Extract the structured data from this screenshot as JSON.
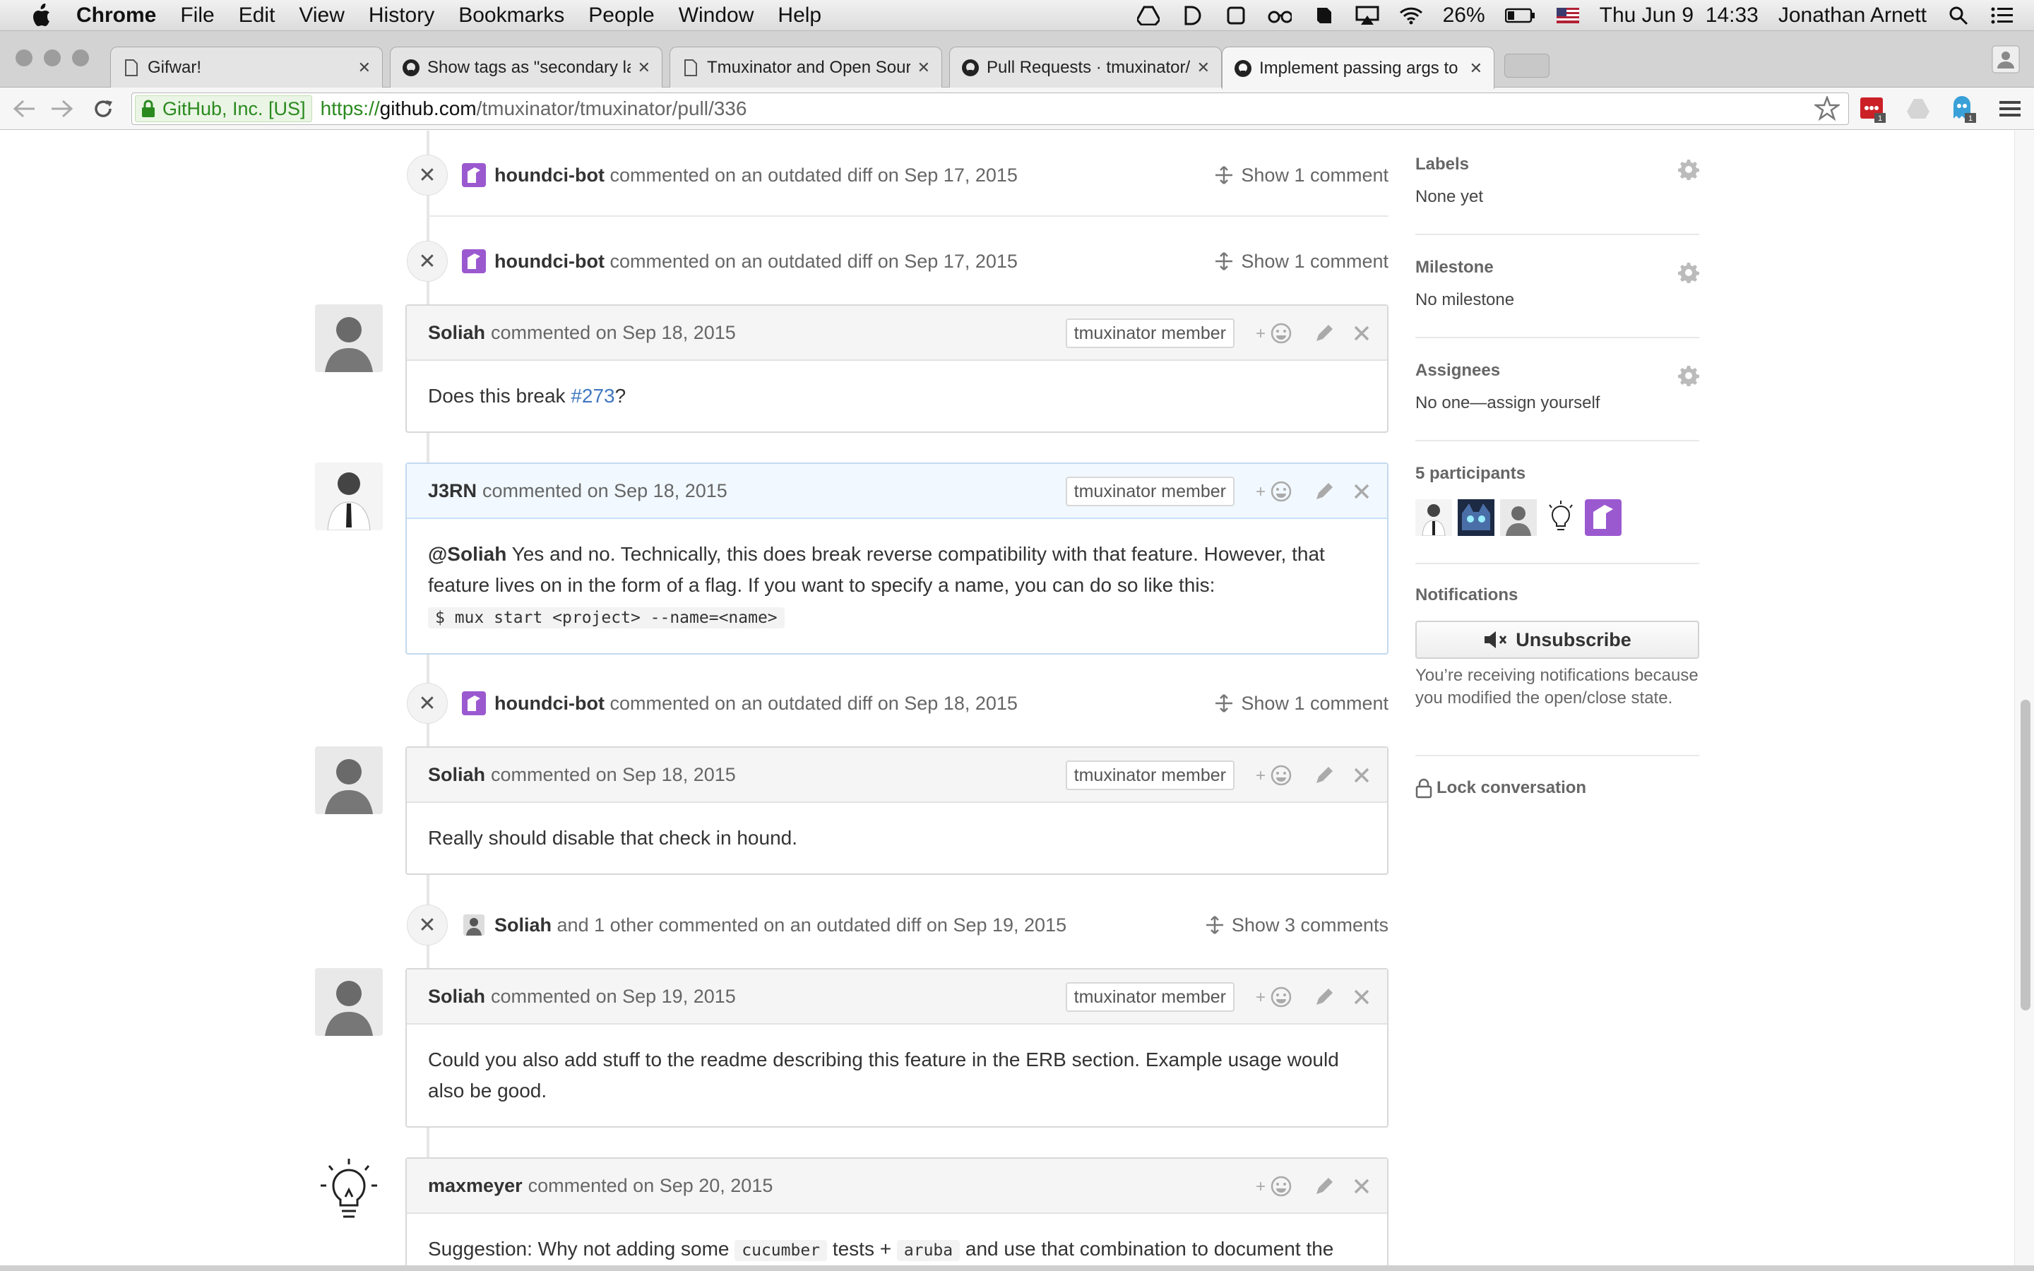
{
  "menubar": {
    "app": "Chrome",
    "items": [
      "File",
      "Edit",
      "View",
      "History",
      "Bookmarks",
      "People",
      "Window",
      "Help"
    ],
    "battery": "26%",
    "clock": "Thu Jun 9  14:33",
    "user": "Jonathan Arnett"
  },
  "tabs": [
    {
      "title": "Gifwar!",
      "icon": "document-icon"
    },
    {
      "title": "Show tags as \"secondary la",
      "icon": "github-icon"
    },
    {
      "title": "Tmuxinator and Open Sourc",
      "icon": "document-icon"
    },
    {
      "title": "Pull Requests · tmuxinator/t",
      "icon": "github-icon"
    },
    {
      "title": "Implement passing args to",
      "icon": "github-icon"
    }
  ],
  "address": {
    "ev_label": "GitHub, Inc. [US]",
    "scheme": "https://",
    "host": "github.com",
    "path": "/tmuxinator/tmuxinator/pull/336",
    "ext_badge_1": "1",
    "ext_badge_2": "1"
  },
  "timeline": {
    "outdated": [
      {
        "author": "houndci-bot",
        "text": "commented on an outdated diff on Sep 17, 2015",
        "show": "Show 1 comment"
      },
      {
        "author": "houndci-bot",
        "text": "commented on an outdated diff on Sep 17, 2015",
        "show": "Show 1 comment"
      },
      {
        "author": "houndci-bot",
        "text": "commented on an outdated diff on Sep 18, 2015",
        "show": "Show 1 comment"
      },
      {
        "author": "Soliah",
        "text": "and 1 other commented on an outdated diff on Sep 19, 2015",
        "show": "Show 3 comments"
      }
    ],
    "comments": [
      {
        "author": "Soliah",
        "meta": "commented on Sep 18, 2015",
        "badge": "tmuxinator member",
        "body_pre": "Does this break ",
        "body_link": "#273",
        "body_post": "?"
      },
      {
        "author": "J3RN",
        "meta": "commented on Sep 18, 2015",
        "badge": "tmuxinator member",
        "mention": "@Soliah",
        "body": "Yes and no. Technically, this does break reverse compatibility with that feature. However, that feature lives on in the form of a flag. If you want to specify a name, you can do so like this:",
        "code": "$ mux start <project> --name=<name>"
      },
      {
        "author": "Soliah",
        "meta": "commented on Sep 18, 2015",
        "badge": "tmuxinator member",
        "body": "Really should disable that check in hound."
      },
      {
        "author": "Soliah",
        "meta": "commented on Sep 19, 2015",
        "badge": "tmuxinator member",
        "body": "Could you also add stuff to the readme describing this feature in the ERB section. Example usage would also be good."
      },
      {
        "author": "maxmeyer",
        "meta": "commented on Sep 20, 2015",
        "body_pre": "Suggestion: Why not adding some ",
        "code1": "cucumber",
        "body_mid": " tests + ",
        "code2": "aruba",
        "body_post": " and use that combination to document the"
      }
    ],
    "reaction_label": "+"
  },
  "sidebar": {
    "labels_title": "Labels",
    "labels_value": "None yet",
    "milestone_title": "Milestone",
    "milestone_value": "No milestone",
    "assignees_title": "Assignees",
    "assignees_value": "No one—assign yourself",
    "participants_title": "5 participants",
    "notifications_title": "Notifications",
    "unsubscribe_label": "Unsubscribe",
    "notifications_note": "You’re receiving notifications because you modified the open/close state.",
    "lock_label": "Lock conversation"
  },
  "colors": {
    "link": "#4078c0",
    "hound": "#9b59d0",
    "ev_green": "#2a8a1f"
  }
}
